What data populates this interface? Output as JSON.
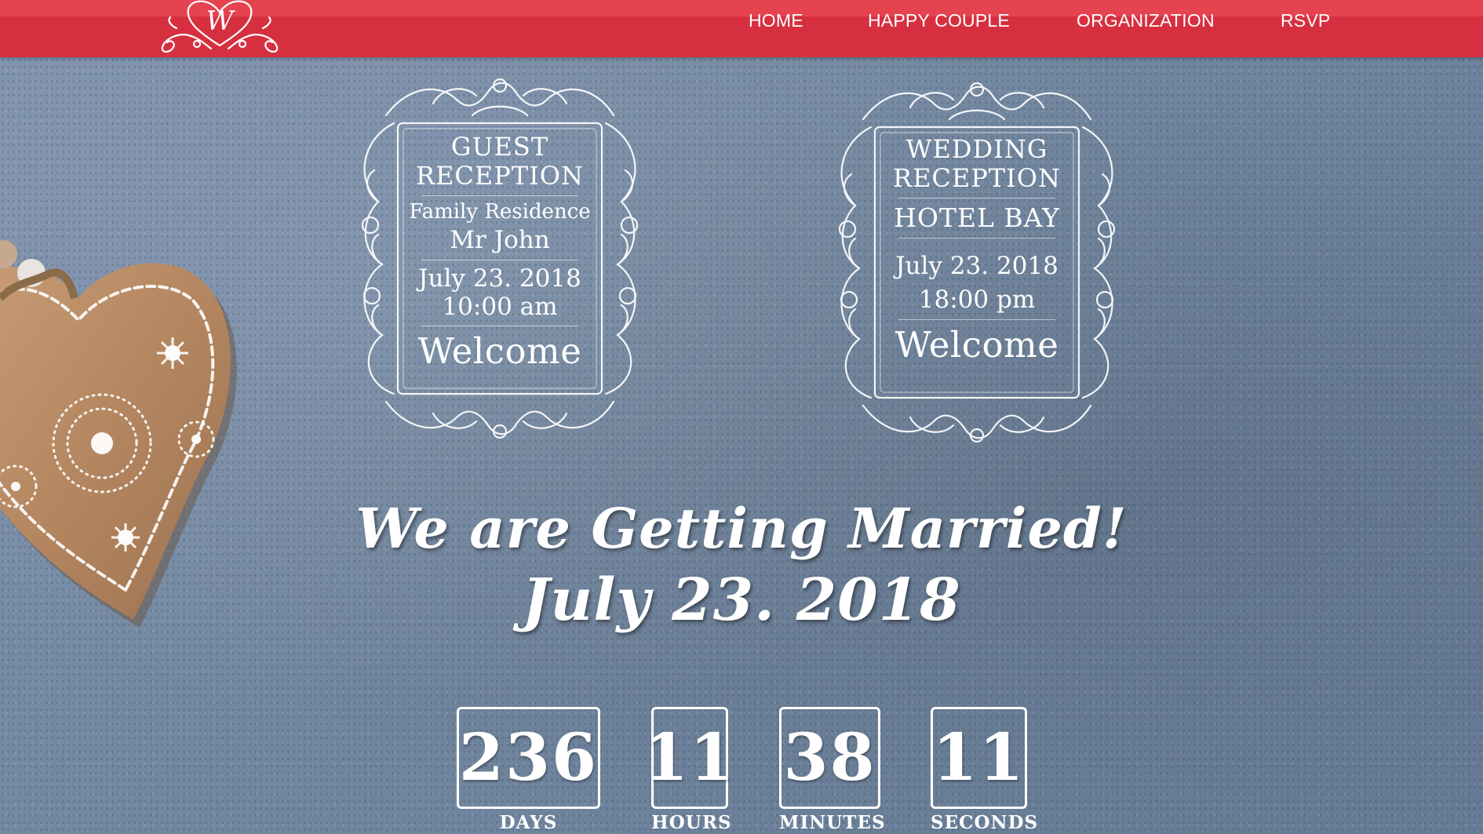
{
  "nav": {
    "logo_letter": "W",
    "items": [
      {
        "label": "HOME"
      },
      {
        "label": "HAPPY COUPLE"
      },
      {
        "label": "ORGANIZATION"
      },
      {
        "label": "RSVP"
      }
    ]
  },
  "guest_card": {
    "title_line1": "GUEST",
    "title_line2": "RECEPTION",
    "place": "Family Residence",
    "host": "Mr John",
    "date": "July 23. 2018",
    "time": "10:00 am",
    "greeting": "Welcome"
  },
  "wedding_card": {
    "title_line1": "WEDDING",
    "title_line2": "RECEPTION",
    "venue": "HOTEL BAY",
    "date": "July 23. 2018",
    "time": "18:00 pm",
    "greeting": "Welcome"
  },
  "headline": {
    "line1": "We are Getting Married!",
    "line2": "July 23. 2018"
  },
  "countdown": {
    "days": {
      "value": "236",
      "label": "DAYS"
    },
    "hours": {
      "value": "11",
      "label": "HOURS"
    },
    "minutes": {
      "value": "38",
      "label": "MINUTES"
    },
    "seconds": {
      "value": "11",
      "label": "SECONDS"
    }
  },
  "colors": {
    "nav_red": "#d63040",
    "background_slate": "#7489a3",
    "text": "#ffffff",
    "heart_wood": "#b98a63"
  },
  "icons": [
    "monogram-heart-logo-icon",
    "ornamental-frame-icon",
    "wooden-heart-decoration-icon"
  ]
}
